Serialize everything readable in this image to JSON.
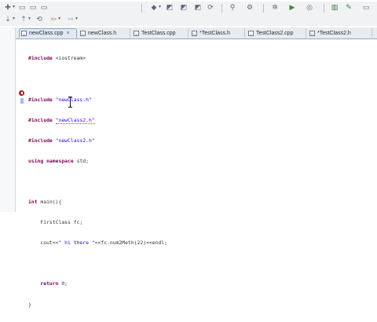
{
  "toolbar_row1": {
    "buttons": [
      {
        "name": "new-icon",
        "glyph": "✚"
      },
      {
        "name": "dropdown-arrow-icon",
        "glyph": "▾"
      },
      {
        "name": "save-icon",
        "glyph": "▭"
      },
      {
        "name": "save-all-icon",
        "glyph": "▭"
      },
      {
        "name": "print-icon",
        "glyph": "▭"
      },
      {
        "name": "build-icon",
        "glyph": "◆"
      },
      {
        "name": "build-dropdown-icon",
        "glyph": "▾"
      },
      {
        "name": "new-class-icon",
        "glyph": "◩"
      },
      {
        "name": "new-file-icon",
        "glyph": "◩"
      },
      {
        "name": "new-folder-icon",
        "glyph": "◩"
      },
      {
        "name": "refresh-icon",
        "glyph": "⟳"
      },
      {
        "name": "search-icon",
        "glyph": "⚲"
      },
      {
        "name": "tools-icon",
        "glyph": "⚙"
      },
      {
        "name": "debug-icon",
        "glyph": "✲"
      },
      {
        "name": "run-icon",
        "glyph": "▶"
      },
      {
        "name": "external-tools-icon",
        "glyph": "◎"
      },
      {
        "name": "open-perspective-icon",
        "glyph": "▥"
      },
      {
        "name": "edit-icon",
        "glyph": "✎"
      },
      {
        "name": "more-icon",
        "glyph": "▭"
      }
    ]
  },
  "toolbar_row2": {
    "buttons": [
      {
        "name": "next-annotation-icon",
        "glyph": "⇣"
      },
      {
        "name": "prev-annotation-icon",
        "glyph": "⇡"
      },
      {
        "name": "last-edit-icon",
        "glyph": "⟲"
      },
      {
        "name": "back-icon",
        "glyph": "⇦"
      },
      {
        "name": "forward-icon",
        "glyph": "⇨"
      }
    ]
  },
  "tabs": [
    {
      "label": "newClass.cpp",
      "active": true,
      "close": "×"
    },
    {
      "label": "newClass.h",
      "active": false,
      "close": ""
    },
    {
      "label": "TestClass.cpp",
      "active": false,
      "close": ""
    },
    {
      "label": "*TestClass.h",
      "active": false,
      "close": ""
    },
    {
      "label": "TestClass2.cpp",
      "active": false,
      "close": ""
    },
    {
      "label": "*TestClass2.h",
      "active": false,
      "close": ""
    }
  ],
  "code_lines": [
    "#include <iostream>",
    "",
    "#include \"newClass.h\"",
    "#include \"newClass2.h\"",
    "#include \"newClass2.h\"",
    "using namespace std;",
    "",
    "int main(){",
    "    FirstClass fc;",
    "    cout<<\" hi there \"<<fc.num2Meth(22)<<endl;",
    "",
    "    return 0;",
    "}"
  ],
  "colors": {
    "keyword": "#7f0055",
    "string": "#2a00ff",
    "error_marker": "#d5282a"
  }
}
